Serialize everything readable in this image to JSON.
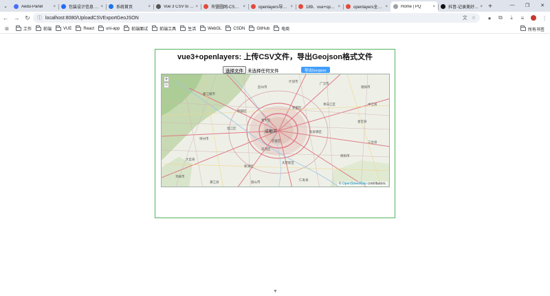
{
  "browser": {
    "tabs": [
      {
        "title": "Aedu-Panel",
        "color": "#4a6cf7"
      },
      {
        "title": "包装设计信息 - 飞书云...",
        "color": "#1f6bff"
      },
      {
        "title": "系统首页",
        "color": "#1a73e8"
      },
      {
        "title": "Vue 3 CSV to GeoJSON...",
        "color": "#555555"
      },
      {
        "title": "市暨圆网-CSDN博客",
        "color": "#e34a3a"
      },
      {
        "title": "openlayers导出CSV...",
        "color": "#e34a3a"
      },
      {
        "title": "189、vue+openlayers...",
        "color": "#e34a3a"
      },
      {
        "title": "openlayers全面...",
        "color": "#e34a3a"
      },
      {
        "title": "Home | PQ",
        "color": "#9aa0a6",
        "active": true
      },
      {
        "title": "抖音-记录美好生活",
        "color": "#111111"
      }
    ],
    "url": "localhost:8080/UploadCSVExportGeoJSON",
    "bookmarks": [
      "工作",
      "前端",
      "VUE",
      "React",
      "uni-app",
      "前端面试",
      "前端工具",
      "生活",
      "WebGL",
      "CSDN",
      "GitHub",
      "电商"
    ],
    "all_bookmarks": "所有书签"
  },
  "page": {
    "title": "vue3+openlayers: 上传CSV文件，导出Geojson格式文件",
    "file_button": "选择文件",
    "file_status": "未选择任何文件",
    "export_button": "导出Geojson",
    "zoom_in": "+",
    "zoom_out": "−",
    "attribution_prefix": "©",
    "attribution_link": "OpenStreetMap",
    "attribution_suffix": "contributors."
  },
  "map": {
    "center_label": "成都市",
    "place_labels": [
      "郫都区",
      "新都区",
      "温江区",
      "双流区",
      "龙泉驿区",
      "青白江区",
      "彭州市",
      "都江堰市",
      "崇州市",
      "大邑县",
      "新津区",
      "金堂县",
      "简阳市",
      "天府新区",
      "广汉市",
      "什邡市",
      "德阳市",
      "邛崃市",
      "蒲江县",
      "仁寿县",
      "眉山市",
      "中江县",
      "三台县",
      "金牛区",
      "武侯区"
    ]
  }
}
